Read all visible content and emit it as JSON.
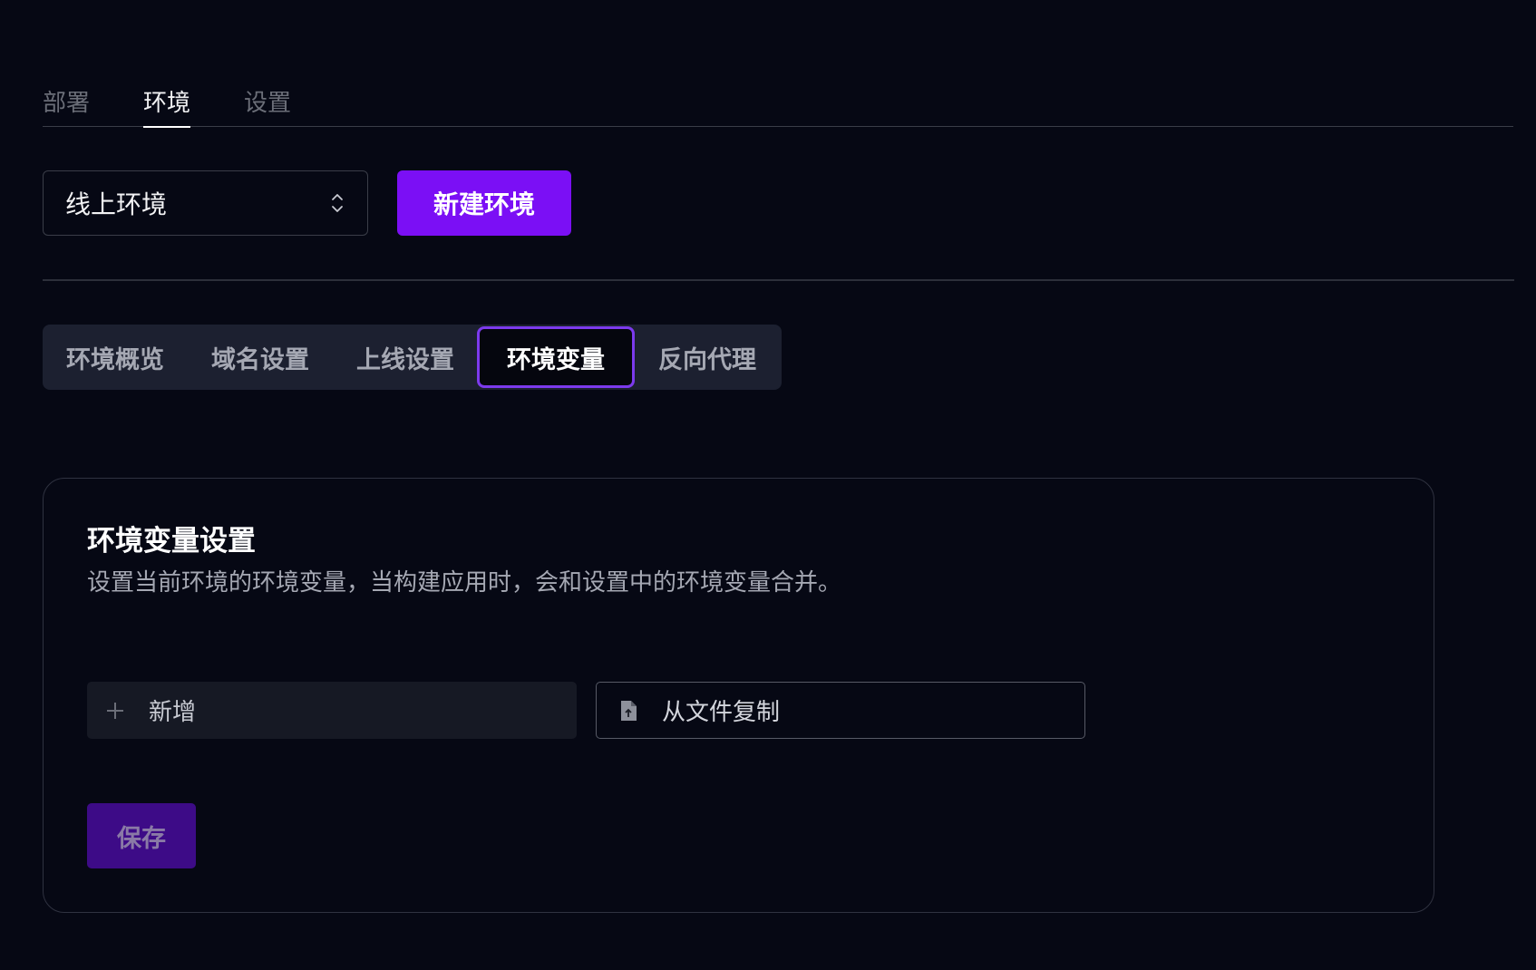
{
  "top_tabs": [
    {
      "label": "部署",
      "active": false
    },
    {
      "label": "环境",
      "active": true
    },
    {
      "label": "设置",
      "active": false
    }
  ],
  "env_select": {
    "value": "线上环境",
    "icon": "chevron-up-down-icon"
  },
  "new_env_button": {
    "label": "新建环境",
    "color": "#7b0ff5"
  },
  "sub_tabs": [
    {
      "label": "环境概览",
      "active": false
    },
    {
      "label": "域名设置",
      "active": false
    },
    {
      "label": "上线设置",
      "active": false
    },
    {
      "label": "环境变量",
      "active": true
    },
    {
      "label": "反向代理",
      "active": false
    }
  ],
  "card": {
    "title": "环境变量设置",
    "description": "设置当前环境的环境变量，当构建应用时，会和设置中的环境变量合并。",
    "add_button": {
      "label": "新增",
      "icon": "plus-icon"
    },
    "copy_button": {
      "label": "从文件复制",
      "icon": "file-upload-icon"
    },
    "save_button": {
      "label": "保存",
      "disabled": true
    }
  },
  "colors": {
    "background": "#060814",
    "accent": "#7b0ff5",
    "active_outline": "#7c3aed"
  }
}
